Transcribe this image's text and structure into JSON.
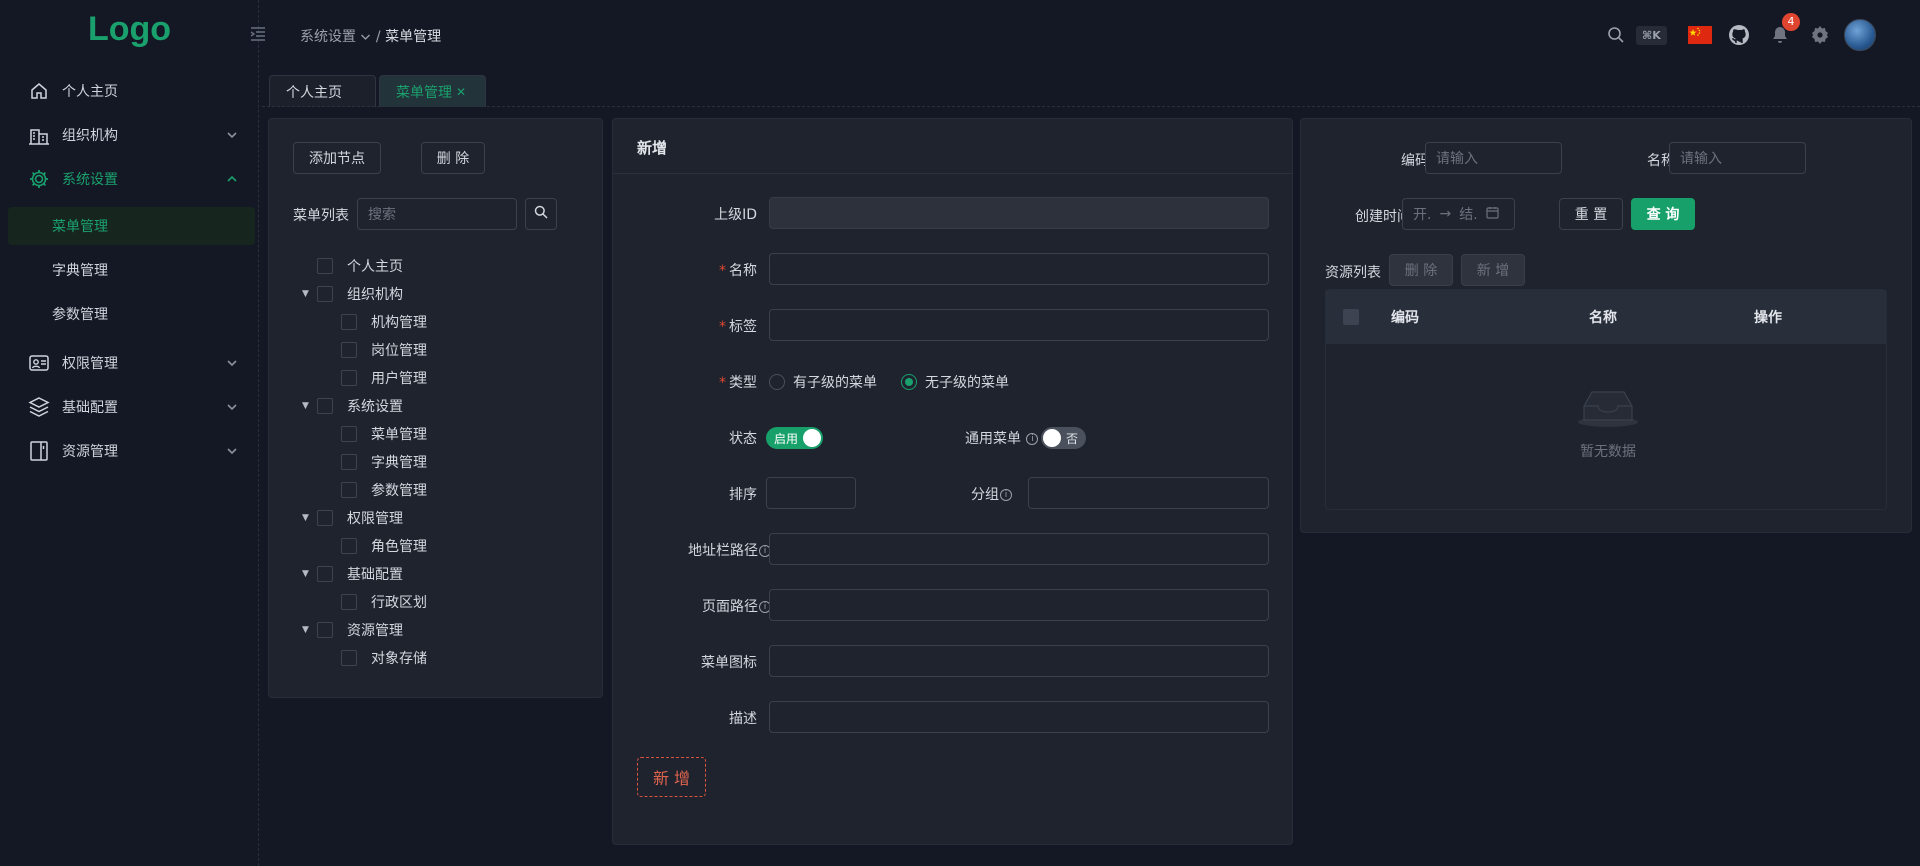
{
  "app": {
    "logo": "Logo"
  },
  "sidebar": {
    "items": [
      {
        "label": "个人主页",
        "icon": "home-icon"
      },
      {
        "label": "组织机构",
        "icon": "building-icon"
      },
      {
        "label": "系统设置",
        "icon": "gear-icon"
      },
      {
        "label": "权限管理",
        "icon": "shield-icon"
      },
      {
        "label": "基础配置",
        "icon": "layers-icon"
      },
      {
        "label": "资源管理",
        "icon": "book-icon"
      }
    ],
    "sub_items": [
      "菜单管理",
      "字典管理",
      "参数管理"
    ]
  },
  "header": {
    "breadcrumb_parent": "系统设置",
    "breadcrumb_sep": "/",
    "breadcrumb_current": "菜单管理",
    "shortcut": "⌘K",
    "notification_count": "4"
  },
  "tabs": [
    {
      "label": "个人主页"
    },
    {
      "label": "菜单管理"
    }
  ],
  "tree_panel": {
    "add_button": "添加节点",
    "delete_button": "删 除",
    "list_label": "菜单列表",
    "search_placeholder": "搜索",
    "nodes": [
      {
        "label": "个人主页"
      },
      {
        "label": "组织机构"
      },
      {
        "label": "机构管理"
      },
      {
        "label": "岗位管理"
      },
      {
        "label": "用户管理"
      },
      {
        "label": "系统设置"
      },
      {
        "label": "菜单管理"
      },
      {
        "label": "字典管理"
      },
      {
        "label": "参数管理"
      },
      {
        "label": "权限管理"
      },
      {
        "label": "角色管理"
      },
      {
        "label": "基础配置"
      },
      {
        "label": "行政区划"
      },
      {
        "label": "资源管理"
      },
      {
        "label": "对象存储"
      }
    ]
  },
  "form": {
    "title": "新增",
    "parent_id_label": "上级ID",
    "name_label": "名称",
    "tag_label": "标签",
    "type_label": "类型",
    "type_option_with_children": "有子级的菜单",
    "type_option_without_children": "无子级的菜单",
    "status_label": "状态",
    "status_value": "启用",
    "common_menu_label": "通用菜单",
    "common_menu_value": "否",
    "sort_label": "排序",
    "group_label": "分组",
    "url_path_label": "地址栏路径",
    "page_path_label": "页面路径",
    "menu_icon_label": "菜单图标",
    "description_label": "描述",
    "submit_button": "新 增"
  },
  "resource_panel": {
    "code_label": "编码",
    "code_placeholder": "请输入",
    "name_label": "名称",
    "name_placeholder": "请输入",
    "created_label": "创建时间",
    "date_start_placeholder": "开.",
    "date_arrow": "→",
    "date_end_placeholder": "结.",
    "reset_button": "重 置",
    "query_button": "查 询",
    "list_label": "资源列表",
    "delete_button": "删 除",
    "add_button": "新 增",
    "columns": [
      "编码",
      "名称",
      "操作"
    ],
    "empty_text": "暂无数据"
  },
  "colors": {
    "accent": "#1aa06d",
    "background": "#141824",
    "panel": "#1e232e",
    "danger": "#e0462f"
  }
}
